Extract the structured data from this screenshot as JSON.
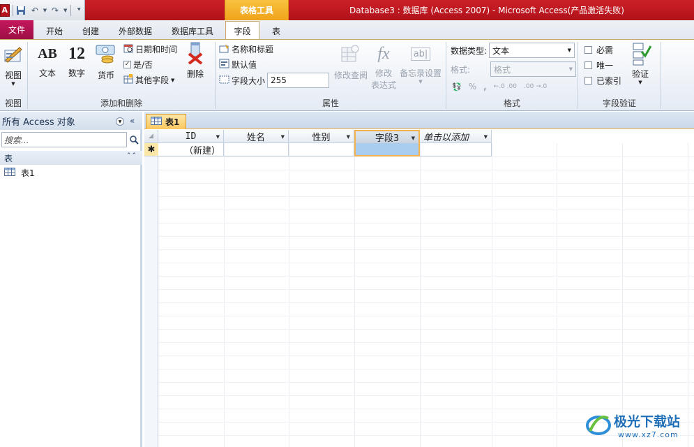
{
  "window": {
    "app_icon": "A",
    "title": "Database3 : 数据库 (Access 2007)  -  Microsoft Access(产品激活失败)",
    "contextual_header": "表格工具"
  },
  "qat": {
    "icons": [
      "save-icon",
      "undo-icon",
      "redo-icon",
      "customize-icon"
    ]
  },
  "tabs": [
    {
      "label": "文件"
    },
    {
      "label": "开始"
    },
    {
      "label": "创建"
    },
    {
      "label": "外部数据"
    },
    {
      "label": "数据库工具"
    },
    {
      "label": "字段"
    },
    {
      "label": "表"
    }
  ],
  "ribbon": {
    "view": {
      "button": "视图",
      "group": "视图"
    },
    "add_delete": {
      "text": "文本",
      "number": "数字",
      "currency": "货币",
      "datetime": "日期和时间",
      "yesno": "是/否",
      "more": "其他字段",
      "delete": "删除",
      "group": "添加和删除"
    },
    "properties": {
      "name_caption": "名称和标题",
      "default_value": "默认值",
      "field_size_label": "字段大小",
      "field_size_value": "255",
      "modify_lookups": "修改查阅",
      "modify_expr_1": "修改",
      "modify_expr_2": "表达式",
      "memo_settings": "备忘录设置",
      "group": "属性"
    },
    "formatting": {
      "data_type_label": "数据类型:",
      "data_type_value": "文本",
      "format_label": "格式:",
      "format_value": "格式",
      "percent": "%",
      "comma": ",",
      "inc_decimals": "←.0 .00",
      "dec_decimals": ".00 →.0",
      "group": "格式"
    },
    "validation": {
      "required": "必需",
      "unique": "唯一",
      "indexed": "已索引",
      "validate": "验证",
      "group": "字段验证"
    }
  },
  "nav": {
    "title": "所有 Access 对象",
    "search_placeholder": "搜索...",
    "group": "表",
    "items": [
      {
        "label": "表1"
      }
    ]
  },
  "document": {
    "tab": "表1",
    "columns": [
      {
        "label": "ID"
      },
      {
        "label": "姓名"
      },
      {
        "label": "性别"
      },
      {
        "label": "字段3"
      },
      {
        "label": "单击以添加"
      }
    ],
    "new_row": {
      "marker": "✱",
      "id_value": "（新建）"
    }
  },
  "watermark": {
    "text": "极光下载站",
    "url": "www.xz7.com"
  }
}
